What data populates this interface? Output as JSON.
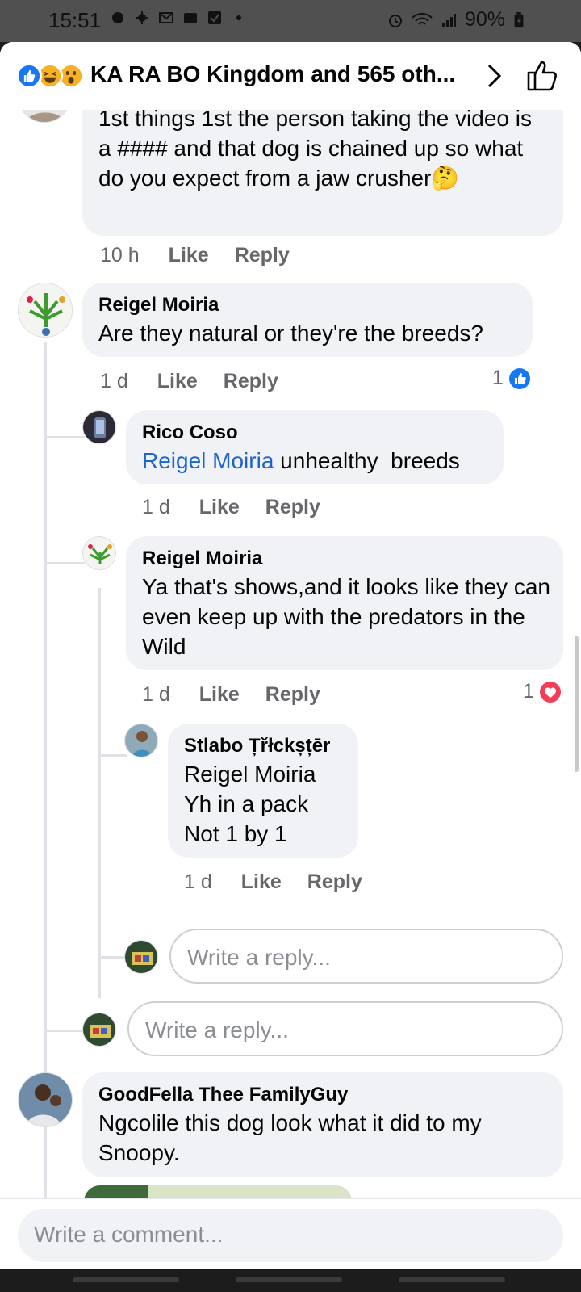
{
  "status_bar": {
    "time": "15:51",
    "battery": "90%"
  },
  "header": {
    "title": "KA RA BO Kingdom and 565 oth..."
  },
  "comments": [
    {
      "text": "1st things 1st the person taking the video is a #### and that dog is chained up so what do you expect from a jaw crusher🤔",
      "time": "10 h",
      "like": "Like",
      "reply": "Reply"
    },
    {
      "name": "Reigel Moiria",
      "text": "Are they natural or they're the breeds?",
      "time": "1 d",
      "like": "Like",
      "reply": "Reply",
      "reaction_count": "1"
    },
    {
      "name": "Rico Coso",
      "mention": "Reigel Moiria",
      "text": " unhealthy  breeds",
      "time": "1 d",
      "like": "Like",
      "reply": "Reply"
    },
    {
      "name": "Reigel Moiria",
      "text": "Ya that's shows,and it looks like they can even keep up with the predators in the Wild",
      "time": "1 d",
      "like": "Like",
      "reply": "Reply",
      "reaction_count": "1"
    },
    {
      "name": "Stlabo Țřłckșțēr",
      "mention": "Reigel Moiria",
      "line1": "Yh in a pack",
      "line2": "Not 1 by 1",
      "time": "1 d",
      "like": "Like",
      "reply": "Reply"
    },
    {
      "name": "GoodFella Thee FamilyGuy",
      "text": "Ngcolile this dog look what it did to my Snoopy."
    }
  ],
  "reply_placeholder": "Write a reply...",
  "comment_placeholder": "Write a comment..."
}
